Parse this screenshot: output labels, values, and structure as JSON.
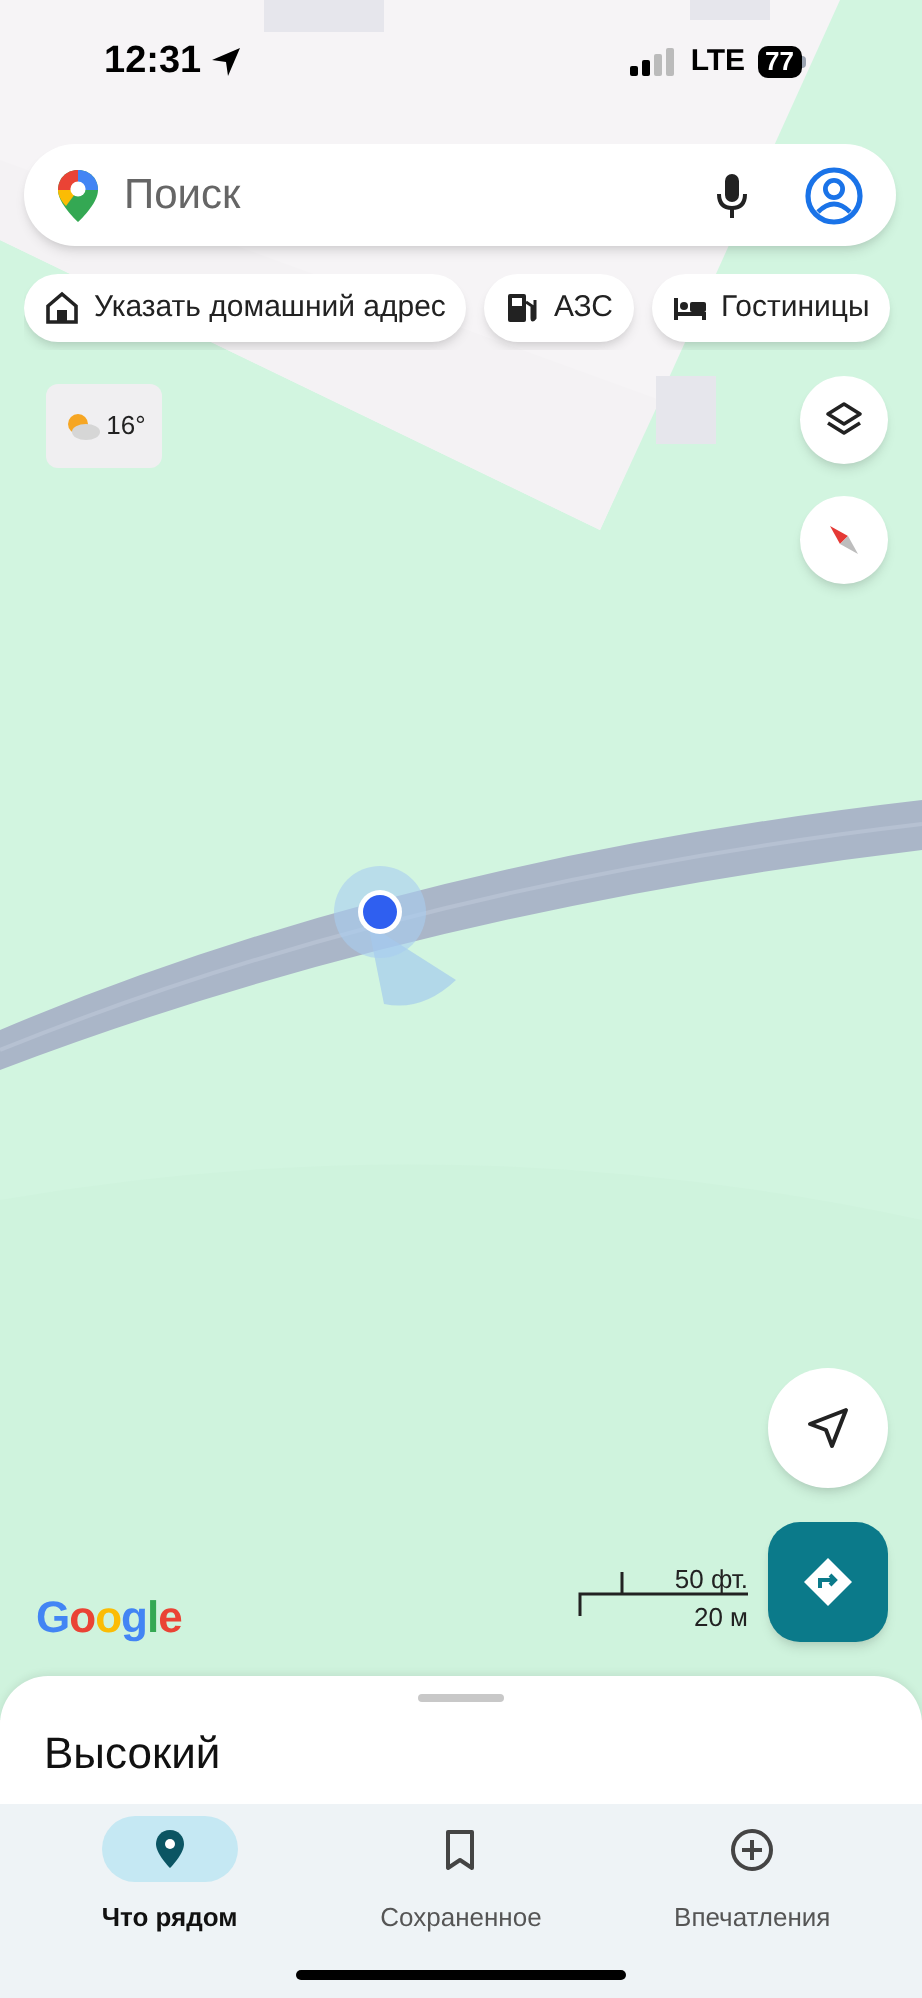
{
  "status_bar": {
    "time": "12:31",
    "network": "LTE",
    "battery": "77"
  },
  "search": {
    "placeholder": "Поиск"
  },
  "chips": [
    {
      "label": "Указать домашний адрес",
      "kind": "home"
    },
    {
      "label": "АЗС",
      "kind": "gas"
    },
    {
      "label": "Гостиницы",
      "kind": "hotel"
    }
  ],
  "weather": {
    "temperature": "16°"
  },
  "attribution": "Google",
  "scale": {
    "imperial": "50 фт.",
    "metric": "20 м"
  },
  "sheet": {
    "title": "Высокий"
  },
  "nav": [
    {
      "label": "Что рядом",
      "selected": true,
      "kind": "explore"
    },
    {
      "label": "Сохраненное",
      "selected": false,
      "kind": "saved"
    },
    {
      "label": "Впечатления",
      "selected": false,
      "kind": "contribute"
    }
  ]
}
